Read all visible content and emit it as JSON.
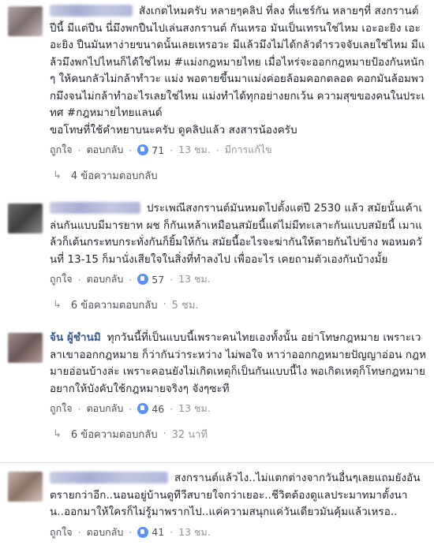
{
  "comments": [
    {
      "name": "",
      "text": "สังเกตไหมครับ หลายๆคลิป ที่ลง ที่แชร์กัน หลายๆที่ สงกรานต์ ปีนี้ มีแต่ปืน นี่มึงพกปืนไปเล่นสงกรานต์ กันเหรอ มันเป็นเทรนใช่ไหม เอะอะยิง เอะอะยิง ปืนมันหาง่ายขนาดนั้นเลยเหรอวะ มีแล้วมึงไม่ได้กลัวตำรวจจับเลยใช่ไหม มีแล้วมึงพกไปไหนก็ได้ใช่ไหม #แม่งกฎหมายไทย เมื่อไหร่จะออกกฎหมายป้องกันหนักๆ ให้คนกลัวไม่กล้าทำวะ แม่ง พอตายขึ้นมาแม่งค่อยล้อมคอกตลอด คอกมันล้อมพวกมึงจนไม่กล้าทำอะไรเลยใช่ไหม แม่งทำได้ทุกอย่างยกเว้น ความสุขของคนในประเทศ #กฎหมายไทยแลนด์\nขอโทษที่ใช้คำหยาบนะครับ ดูคลิปแล้ว สงสารน้องครับ",
      "like": "ถูกใจ",
      "reply": "ตอบกลับ",
      "reactions": "71",
      "time": "13 ชม.",
      "edited": "มีการแก้ไข",
      "replies_label": "4 ข้อความตอบกลับ"
    },
    {
      "name": "",
      "text": "ประเพณีสงกรานต์มันหมดไปตั้งแต่ปี 2530 แล้ว สมัยนั้นเค้าเล่นกันแบบมีมารยาท ผช ก็กันเหล้าเหมือนสมัยนี้แต่ไม่มีทะเลาะกันแบบสมัยนี้ เมาแล้วก็เต้นกระทบกระทั่งกันก็ยิ้มให้กัน สมัยนี้อะไรจะฆ่ากันให้ตายกันไปข้าง พอหมดวันที่ 13-15 ก็มานั่งเสียใจในสิ่งที่ทำลงไป เพื่ออะไร เคยถามตัวเองกันบ้างมั้ย",
      "like": "ถูกใจ",
      "reply": "ตอบกลับ",
      "reactions": "57",
      "time": "13 ชม.",
      "edited": "",
      "replies_label": "6 ข้อความตอบกลับ",
      "replies_time": "5 ชม."
    },
    {
      "name": "จ้น ผู้ชำนมิ",
      "text": "ทุกวันนี้ที่เป็นแบบนี้เพราะคนไทยเองทั้งนั้น อย่าโทษกฎหมาย เพราะเวลาเขาออกกฎหมาย ก็ว่ากันว่าระหว่าง ไม่พอใจ หาว่าออกกฎหมายปัญญาอ่อน กฎหมายอ่อนบ้างล่ะ เพราะคอนยังไม่เกิดเหตุก็เป็นกันแบบนี้ไง พอเกิดเหตุก็โทษกฎหมาย อยากให้บังคับใช้กฎหมายจริงๆ จังๆซะที",
      "like": "ถูกใจ",
      "reply": "ตอบกลับ",
      "reactions": "46",
      "time": "13 ชม.",
      "edited": "",
      "replies_label": "6 ข้อความตอบกลับ",
      "replies_time": "32 นาที"
    },
    {
      "name": "",
      "text": "สงกรานต์แล้วไง..ไม่แตกต่างจากวันอื่นๆเลยแถมยังอันตรายกว่าอีก..นอนอยู่บ้านดูทีวีสบายใจกว่าเยอะ..ชีวิตต้องดูแลประมาทมาตั้งนาน..ออกมาให้ใครก็ไม่รู้มาพรากไป..แค่ความสนุกแค่วันเดียวมันคุ้มแล้วเหรอ..",
      "like": "ถูกใจ",
      "reply": "ตอบกลับ",
      "reactions": "41",
      "time": "13 ชม.",
      "edited": ""
    }
  ]
}
